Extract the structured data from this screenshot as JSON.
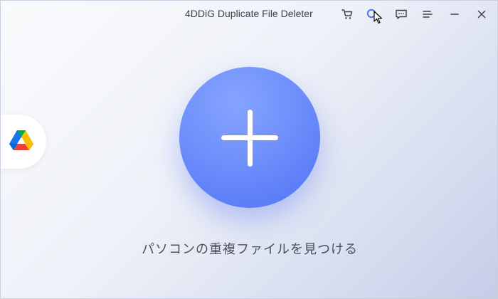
{
  "window": {
    "title": "4DDiG Duplicate File Deleter"
  },
  "titlebar_buttons": [
    {
      "name": "cart-icon"
    },
    {
      "name": "search-icon"
    },
    {
      "name": "feedback-icon"
    },
    {
      "name": "menu-icon"
    },
    {
      "name": "minimize-icon"
    },
    {
      "name": "close-icon"
    }
  ],
  "sidebar": {
    "icon": "google-drive-icon"
  },
  "main": {
    "add_button_icon": "plus-icon",
    "caption": "パソコンの重複ファイルを見つける"
  },
  "colors": {
    "accent": "#5a7cf6",
    "text": "#3a3f4b"
  }
}
